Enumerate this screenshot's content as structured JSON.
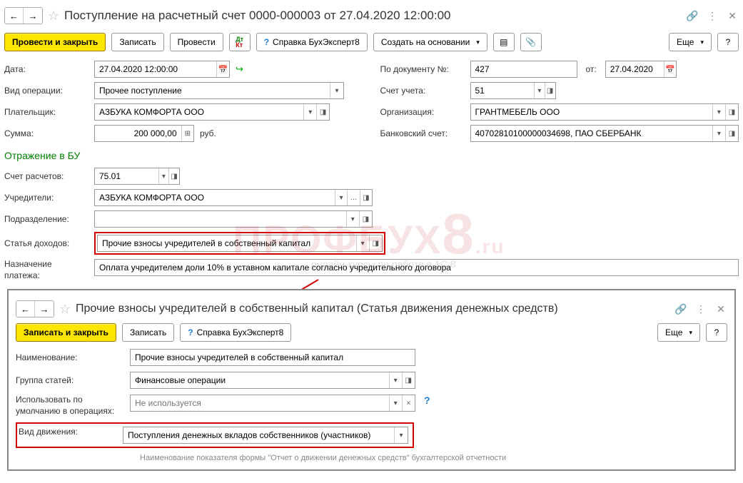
{
  "header": {
    "title": "Поступление на расчетный счет 0000-000003 от 27.04.2020 12:00:00"
  },
  "toolbar": {
    "post_close": "Провести и закрыть",
    "save": "Записать",
    "post": "Провести",
    "help": "Справка БухЭксперт8",
    "create_based": "Создать на основании",
    "more": "Еще",
    "q": "?"
  },
  "form": {
    "date_label": "Дата:",
    "date_value": "27.04.2020 12:00:00",
    "docnum_label": "По документу №:",
    "docnum_value": "427",
    "of_label": "от:",
    "of_value": "27.04.2020",
    "optype_label": "Вид операции:",
    "optype_value": "Прочее поступление",
    "account_label": "Счет учета:",
    "account_value": "51",
    "payer_label": "Плательщик:",
    "payer_value": "АЗБУКА КОМФОРТА ООО",
    "org_label": "Организация:",
    "org_value": "ГРАНТМЕБЕЛЬ ООО",
    "sum_label": "Сумма:",
    "sum_value": "200 000,00",
    "rub": "руб.",
    "bank_label": "Банковский счет:",
    "bank_value": "40702810100000034698, ПАО СБЕРБАНК",
    "section": "Отражение в БУ",
    "settle_label": "Счет расчетов:",
    "settle_value": "75.01",
    "founders_label": "Учредители:",
    "founders_value": "АЗБУКА КОМФОРТА ООО",
    "division_label": "Подразделение:",
    "division_value": "",
    "income_label": "Статья доходов:",
    "income_value": "Прочие взносы учредителей в собственный капитал",
    "purpose_label": "Назначение платежа:",
    "purpose_value": "Оплата учредителем доли 10% в уставном капитале согласно учредительного договора"
  },
  "popup": {
    "title": "Прочие взносы учредителей в собственный капитал (Статья движения денежных средств)",
    "save_close": "Записать и закрыть",
    "save": "Записать",
    "help": "Справка БухЭксперт8",
    "more": "Еще",
    "q": "?",
    "name_label": "Наименование:",
    "name_value": "Прочие взносы учредителей в собственный капитал",
    "group_label": "Группа статей:",
    "group_value": "Финансовые операции",
    "use_default_label1": "Использовать по",
    "use_default_label2": "умолчанию в операциях:",
    "use_default_placeholder": "Не используется",
    "kind_label": "Вид движения:",
    "kind_value": "Поступления денежных вкладов собственников (участников)",
    "hint": "Наименование показателя формы \"Отчет о движении денежных средств\" бухгалтерской отчетности"
  }
}
